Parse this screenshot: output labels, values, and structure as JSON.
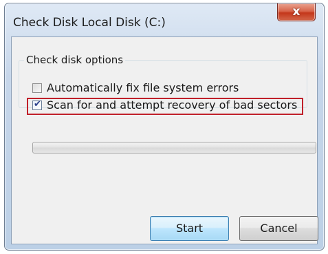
{
  "window": {
    "title": "Check Disk Local Disk (C:)",
    "close_glyph": "x"
  },
  "group": {
    "legend": "Check disk options"
  },
  "options": [
    {
      "label": "Automatically fix file system errors",
      "checked": false
    },
    {
      "label": "Scan for and attempt recovery of bad sectors",
      "checked": true
    }
  ],
  "progress": {
    "value": 0
  },
  "buttons": {
    "start_label": "Start",
    "cancel_label": "Cancel"
  },
  "icons": {
    "close": "close-icon",
    "check": "checkmark-icon"
  },
  "colors": {
    "highlight": "#c0202a",
    "close_button": "#c4371b",
    "default_button_border": "#3c7fb1"
  }
}
